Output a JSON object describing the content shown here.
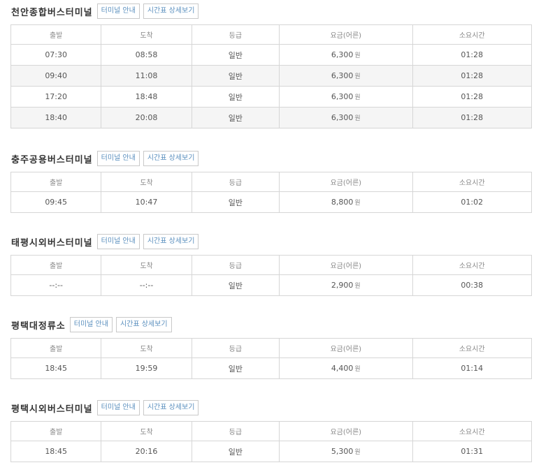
{
  "columns": [
    "출발",
    "도착",
    "등급",
    "요금(어른)",
    "소요시간"
  ],
  "fare_unit": "원",
  "buttons": {
    "terminal_info": "터미널 안내",
    "timetable_detail": "시간표 상세보기"
  },
  "terminals": [
    {
      "name": "천안종합버스터미널",
      "rows": [
        {
          "dep": "07:30",
          "arr": "08:58",
          "grade": "일반",
          "fare": "6,300",
          "duration": "01:28"
        },
        {
          "dep": "09:40",
          "arr": "11:08",
          "grade": "일반",
          "fare": "6,300",
          "duration": "01:28"
        },
        {
          "dep": "17:20",
          "arr": "18:48",
          "grade": "일반",
          "fare": "6,300",
          "duration": "01:28"
        },
        {
          "dep": "18:40",
          "arr": "20:08",
          "grade": "일반",
          "fare": "6,300",
          "duration": "01:28"
        }
      ]
    },
    {
      "name": "충주공용버스터미널",
      "rows": [
        {
          "dep": "09:45",
          "arr": "10:47",
          "grade": "일반",
          "fare": "8,800",
          "duration": "01:02"
        }
      ]
    },
    {
      "name": "태평시외버스터미널",
      "rows": [
        {
          "dep": "--:--",
          "arr": "--:--",
          "grade": "일반",
          "fare": "2,900",
          "duration": "00:38"
        }
      ]
    },
    {
      "name": "평택대정류소",
      "rows": [
        {
          "dep": "18:45",
          "arr": "19:59",
          "grade": "일반",
          "fare": "4,400",
          "duration": "01:14"
        }
      ]
    },
    {
      "name": "평택시외버스터미널",
      "rows": [
        {
          "dep": "18:45",
          "arr": "20:16",
          "grade": "일반",
          "fare": "5,300",
          "duration": "01:31"
        }
      ]
    }
  ]
}
